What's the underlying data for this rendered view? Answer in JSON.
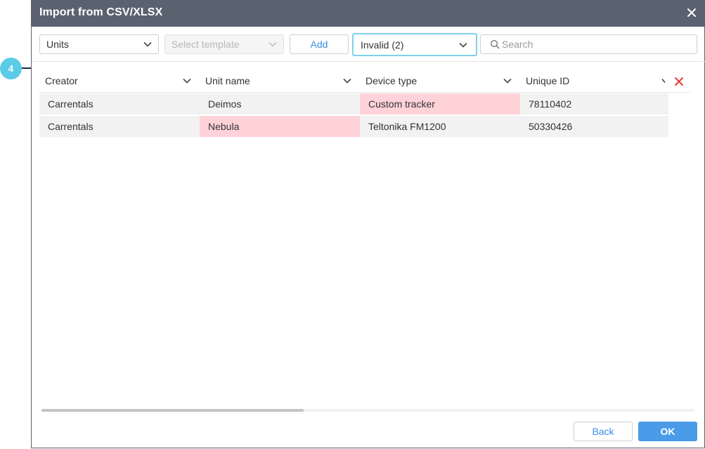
{
  "dialog": {
    "title": "Import from CSV/XLSX"
  },
  "toolbar": {
    "type_select": "Units",
    "template_select_placeholder": "Select template",
    "add_label": "Add",
    "filter_select": "Invalid (2)",
    "search_placeholder": "Search"
  },
  "callout": {
    "number": "4"
  },
  "table": {
    "columns": [
      {
        "label": "Creator"
      },
      {
        "label": "Unit name"
      },
      {
        "label": "Device type"
      },
      {
        "label": "Unique ID"
      }
    ],
    "rows": [
      {
        "creator": "Carrentals",
        "unit_name": "Deimos",
        "device_type": "Custom tracker",
        "unique_id": "78110402"
      },
      {
        "creator": "Carrentals",
        "unit_name": "Nebula",
        "device_type": "Teltonika FM1200",
        "unique_id": "50330426"
      }
    ]
  },
  "footer": {
    "back_label": "Back",
    "ok_label": "OK"
  },
  "colors": {
    "titlebar": "#5a6270",
    "accent": "#4a9be8",
    "invalid_cell": "#ffd2d8",
    "callout": "#5ccbe8",
    "delete_icon": "#e23b3b"
  },
  "icons": {
    "close": "close-icon",
    "dropdown": "chevron-down-icon",
    "search": "search-icon",
    "delete": "delete-x-icon"
  }
}
